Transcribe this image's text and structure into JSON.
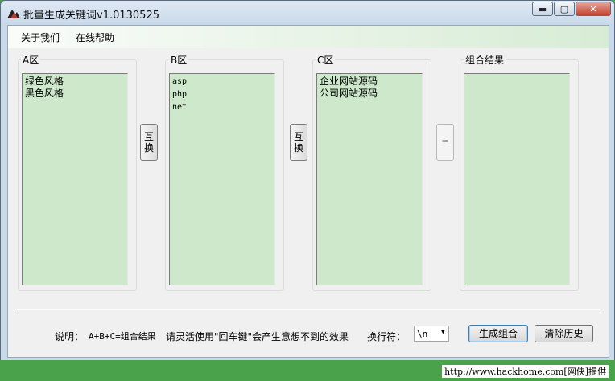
{
  "window": {
    "title": "批量生成关键词v1.0130525",
    "min_label": "▬",
    "max_label": "▢",
    "close_label": "✕"
  },
  "menu": [
    {
      "label": "关于我们"
    },
    {
      "label": "在线帮助"
    }
  ],
  "zones": {
    "a": {
      "label": "A区",
      "items": [
        "绿色风格",
        "黑色风格"
      ]
    },
    "b": {
      "label": "B区",
      "items": [
        "asp",
        "php",
        "net"
      ]
    },
    "c": {
      "label": "C区",
      "items": [
        "企业网站源码",
        "公司网站源码"
      ]
    },
    "result": {
      "label": "组合结果",
      "items": []
    }
  },
  "swap_ab": {
    "line1": "互",
    "line2": "换"
  },
  "swap_bc": {
    "line1": "互",
    "line2": "换"
  },
  "equals_label": "=",
  "footer": {
    "desc_label": "说明：",
    "desc_formula": "A+B+C=组合结果",
    "desc_hint": "请灵活使用\"回车键\"会产生意想不到的效果",
    "newline_label": "换行符：",
    "newline_value": "\\n",
    "generate_label": "生成组合",
    "clear_label": "清除历史"
  },
  "watermark": "http://www.hackhome.com[网侠]提供",
  "colors": {
    "list_bg": "#cde8cb",
    "bottom_bar": "#4aa34a"
  },
  "icons": {
    "app": "mountain-icon",
    "dropdown": "chevron-down-icon"
  }
}
